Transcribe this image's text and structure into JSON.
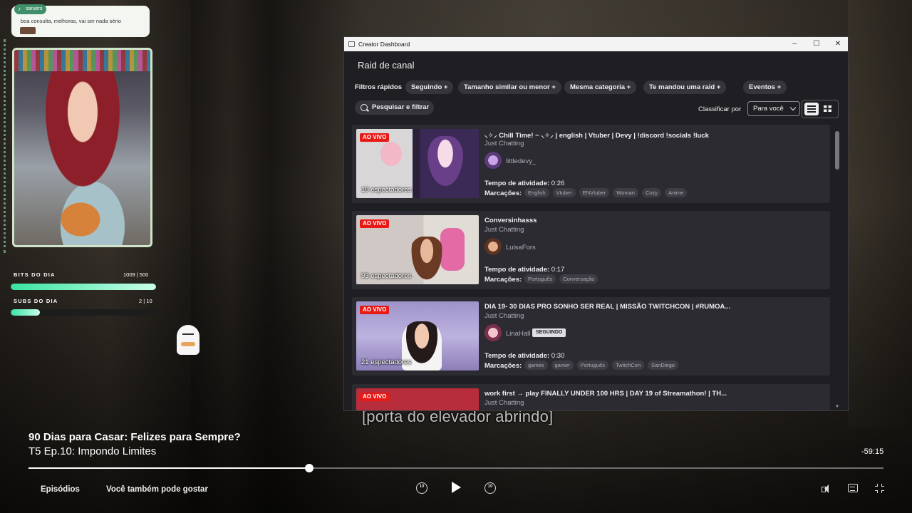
{
  "chat": {
    "username": "saruers",
    "message": "boa consulta, melhoras, vai ser nada sério"
  },
  "overlay": {
    "bits_label": "BITS DO DIA",
    "bits_value": "1009 | 500",
    "bits_progress": 1.0,
    "subs_label": "SUBS DO DIA",
    "subs_value": "2 | 10",
    "subs_progress": 0.2
  },
  "subtitle": "[porta do elevador abrindo]",
  "window": {
    "title": "Creator Dashboard",
    "controls": {
      "minimize": "–",
      "maximize": "☐",
      "close": "✕"
    },
    "page_title": "Raid de canal",
    "filters_label": "Filtros rápidos",
    "filters": [
      "Seguindo +",
      "Tamanho similar ou menor +",
      "Mesma categoria +",
      "Te mandou uma raid +",
      "Eventos +"
    ],
    "search_label": "Pesquisar e filtrar",
    "sort_label": "Classificar por",
    "sort_value": "Para você",
    "live_badge": "AO VIVO",
    "uptime_label": "Tempo de atividade:",
    "tags_label": "Marcações:",
    "streams": [
      {
        "title": "⸜✧⸝ Chill Time! ~ ⸜✧⸝ | english | Vtuber | Devy | !discord !socials !luck",
        "category": "Just Chatting",
        "streamer": "littledevy_",
        "viewers": "10 espectadores",
        "uptime": "0:26",
        "tags": [
          "English",
          "Vtuber",
          "ENVtuber",
          "Woman",
          "Cozy",
          "Anime"
        ],
        "following": ""
      },
      {
        "title": "Conversinhasss",
        "category": "Just Chatting",
        "streamer": "LuisaFors",
        "viewers": "93 espectadores",
        "uptime": "0:17",
        "tags": [
          "Português",
          "Conversação"
        ],
        "following": ""
      },
      {
        "title": "DIA 19- 30 DIAS PRO SONHO SER REAL | MISSÃO TWITCHCON | #RUMOA...",
        "category": "Just Chatting",
        "streamer": "LinaHall",
        "viewers": "21 espectadores",
        "uptime": "0:30",
        "tags": [
          "games",
          "gamer",
          "Português",
          "TwitchCon",
          "SanDiego"
        ],
        "following": "SEGUINDO"
      },
      {
        "title": "work first → play FINALLY UNDER 100 HRS | DAY 19 of Streamathon! | TH...",
        "category": "Just Chatting",
        "streamer": "",
        "viewers": "",
        "uptime": "",
        "tags": [],
        "following": ""
      }
    ]
  },
  "player": {
    "show_title": "90 Dias para Casar: Felizes para Sempre?",
    "episode": "T5 Ep.10: Impondo Limites",
    "remaining": "-59:15",
    "progress": 0.328,
    "episodes_label": "Episódios",
    "recommend_label": "Você também pode gostar",
    "rewind_label": "10",
    "forward_label": "10"
  },
  "colors": {
    "live_red": "#e91916",
    "bar_green": "#39e3a0",
    "window_bg": "#1f1f23",
    "card_bg": "#2b2b31"
  }
}
